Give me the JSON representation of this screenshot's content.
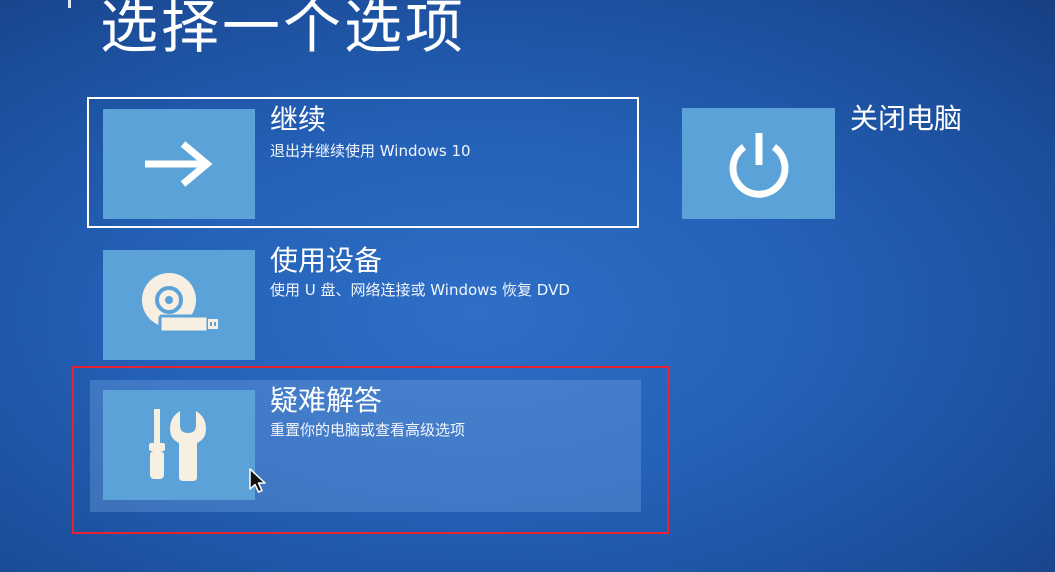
{
  "page": {
    "title": "选择一个选项"
  },
  "options": {
    "continue": {
      "title": "继续",
      "description": "退出并继续使用 Windows 10",
      "icon": "arrow-right-icon"
    },
    "use_device": {
      "title": "使用设备",
      "description": "使用 U 盘、网络连接或 Windows 恢复 DVD",
      "icon": "disc-drive-icon"
    },
    "troubleshoot": {
      "title": "疑难解答",
      "description": "重置你的电脑或查看高级选项",
      "icon": "tools-icon"
    },
    "turn_off": {
      "title": "关闭电脑",
      "icon": "power-icon"
    }
  },
  "colors": {
    "background": "#2461b8",
    "tile": "#5aa2d8",
    "highlight": "#e8232f"
  }
}
